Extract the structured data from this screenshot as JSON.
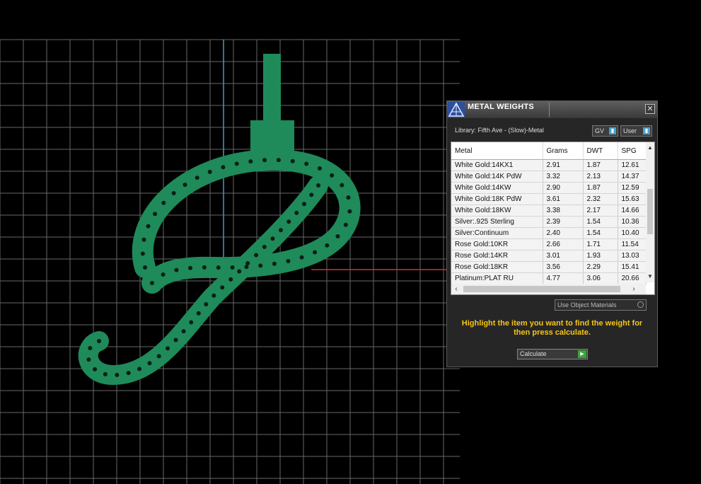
{
  "colors": {
    "background": "#000000",
    "grid_line": "#8a8a8a",
    "model_green": "#1f8a5a",
    "axis_x_red": "#d03030",
    "axis_y_blue": "#3a9ad0",
    "panel_bg": "#262626",
    "hint_yellow": "#f5c518",
    "calculate_green": "#3aa63a"
  },
  "panel": {
    "title": "METAL WEIGHTS",
    "close_icon": "close-icon",
    "library_label": "Library: Fifth Ave - (Slow)-Metal",
    "gv_dropdown": "GV",
    "user_dropdown": "User",
    "table": {
      "headers": [
        "Metal",
        "Grams",
        "DWT",
        "SPG"
      ],
      "rows": [
        [
          "White Gold:14KX1",
          "2.91",
          "1.87",
          "12.61"
        ],
        [
          "White Gold:14K PdW",
          "3.32",
          "2.13",
          "14.37"
        ],
        [
          "White Gold:14KW",
          "2.90",
          "1.87",
          "12.59"
        ],
        [
          "White Gold:18K PdW",
          "3.61",
          "2.32",
          "15.63"
        ],
        [
          "White Gold:18KW",
          "3.38",
          "2.17",
          "14.66"
        ],
        [
          "Silver:.925 Sterling",
          "2.39",
          "1.54",
          "10.36"
        ],
        [
          "Silver:Continuum",
          "2.40",
          "1.54",
          "10.40"
        ],
        [
          "Rose Gold:10KR",
          "2.66",
          "1.71",
          "11.54"
        ],
        [
          "Rose Gold:14KR",
          "3.01",
          "1.93",
          "13.03"
        ],
        [
          "Rose Gold:18KR",
          "3.56",
          "2.29",
          "15.41"
        ],
        [
          "Platinum:PLAT RU",
          "4.77",
          "3.06",
          "20.66"
        ]
      ]
    },
    "use_object_materials": "Use Object Materials",
    "hint": "Highlight the item you want to find the weight for then press calculate.",
    "calculate_label": "Calculate"
  }
}
